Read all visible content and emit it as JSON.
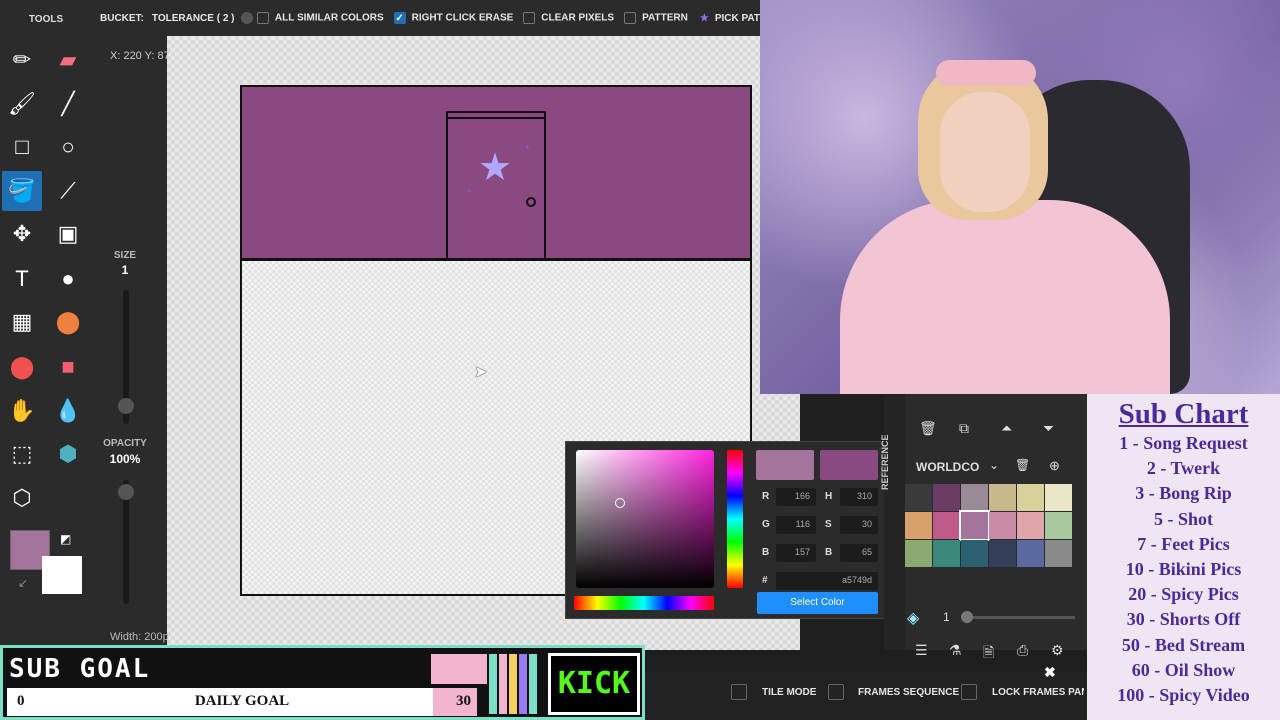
{
  "toolbar": {
    "title": "TOOLS",
    "size_label": "SIZE",
    "size_value": "1",
    "opacity_label": "OPACITY",
    "opacity_value": "100%",
    "width_label": "Width: 200p"
  },
  "topbar": {
    "bucket_label": "BUCKET:",
    "tolerance_label": "TOLERANCE ( 2 )",
    "tolerance_value": 2,
    "options": [
      {
        "label": "ALL SIMILAR COLORS",
        "checked": false
      },
      {
        "label": "RIGHT CLICK ERASE",
        "checked": true
      },
      {
        "label": "CLEAR PIXELS",
        "checked": false
      },
      {
        "label": "PATTERN",
        "checked": false
      }
    ],
    "pick_pattern_label": "PICK PAT"
  },
  "coords": "X: 220 Y: 87",
  "colors": {
    "wall": "#8a4a80",
    "primary_swatch": "#a5749d",
    "accent": "#1f6fb5"
  },
  "picker": {
    "r_label": "R",
    "r_value": "166",
    "g_label": "G",
    "g_value": "116",
    "b_label": "B",
    "b_value": "157",
    "h_label": "H",
    "h_value": "310",
    "s_label": "S",
    "s_value": "30",
    "bv_label": "B",
    "bv_value": "65",
    "hex_label": "#",
    "hex_value": "a5749d",
    "select_label": "Select Color"
  },
  "palette": {
    "reference_label": "REFERENCE",
    "name": "WORLDCO",
    "layer_number": "1",
    "swatches": [
      "#3a3a3a",
      "#6b3d66",
      "#9a8a95",
      "#c8b98d",
      "#d8d29a",
      "#e9e7c8",
      "#d8a06a",
      "#c05a8a",
      "#a5749d",
      "#c98aa8",
      "#e0a5a8",
      "#a8c8a0",
      "#8aaa70",
      "#3a8a7a",
      "#2a6070",
      "#34405a",
      "#5a6aa0",
      "#8a8a8a"
    ]
  },
  "bottombar": {
    "tile_mode": "TILE MODE",
    "frames_sequence": "FRAMES SEQUENCE",
    "lock_frames_panel": "LOCK FRAMES PANEL"
  },
  "subgoal": {
    "title": "SUB GOAL",
    "current": "0",
    "label": "DAILY GOAL",
    "target": "30",
    "kick": "KICK"
  },
  "sub_chart": {
    "title": "Sub Chart",
    "items": [
      "1 - Song Request",
      "2 - Twerk",
      "3 - Bong Rip",
      "5 - Shot",
      "7 - Feet Pics",
      "10 - Bikini Pics",
      "20 - Spicy Pics",
      "30 - Shorts Off",
      "50 - Bed Stream",
      "60 - Oil Show",
      "100 - Spicy Video"
    ]
  }
}
